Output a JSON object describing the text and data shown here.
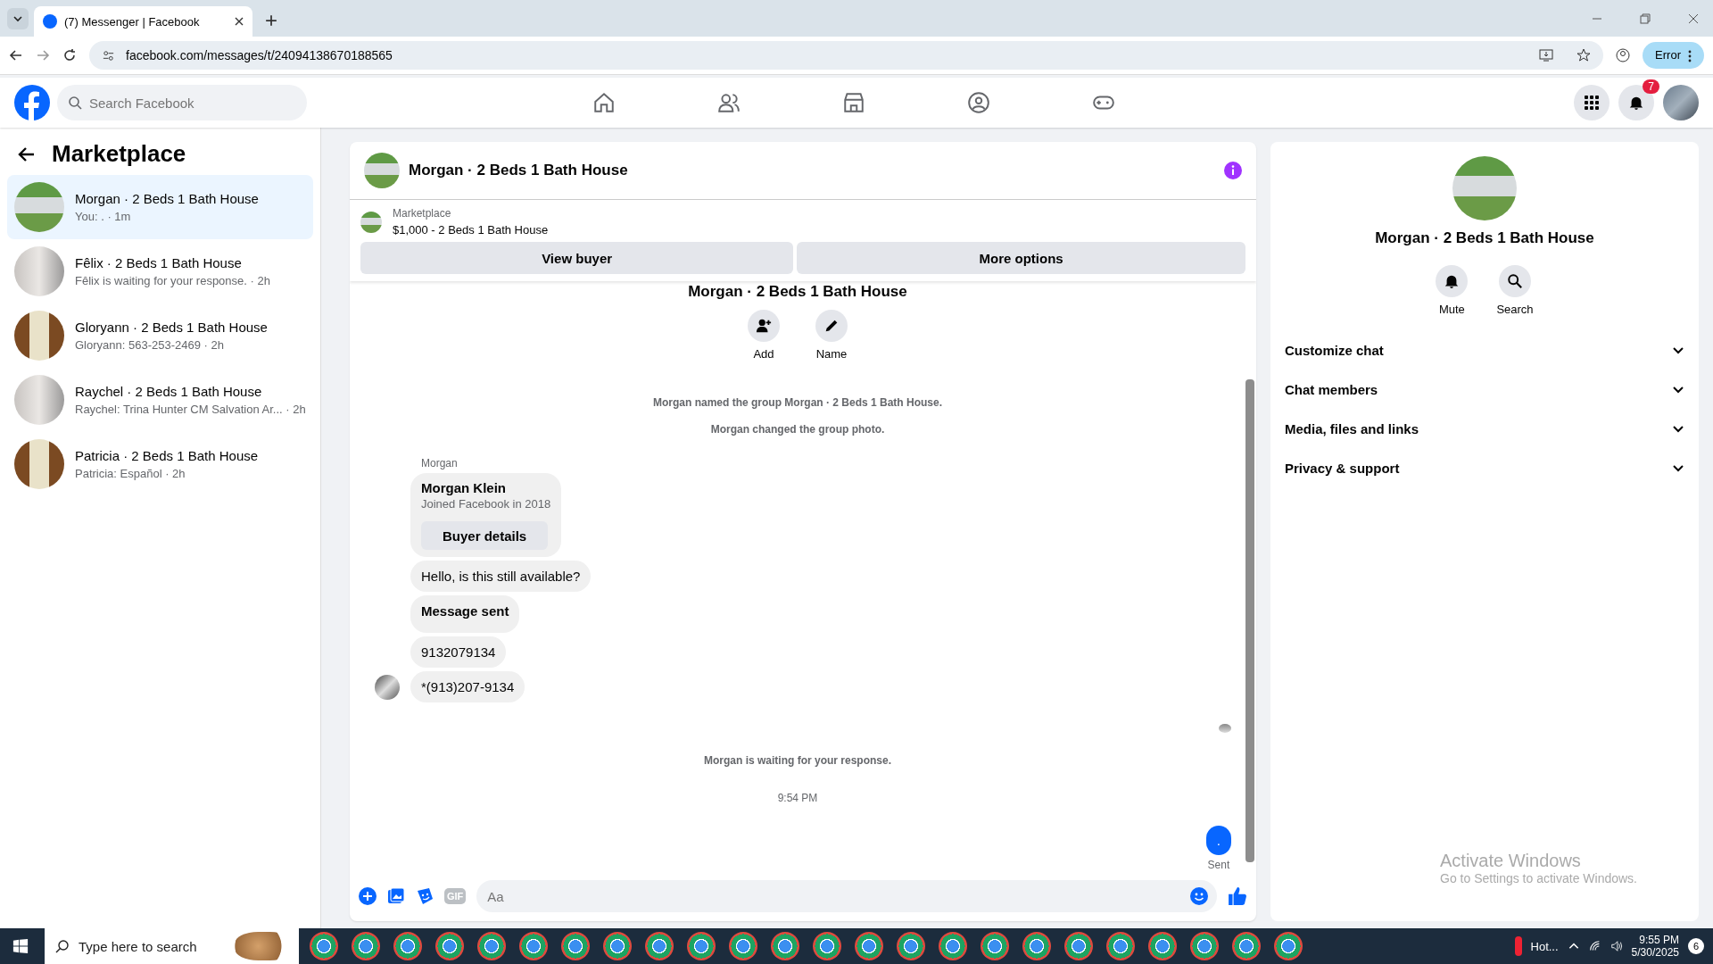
{
  "browser": {
    "tab_title": "(7) Messenger | Facebook",
    "url": "facebook.com/messages/t/24094138670188565",
    "profile_button": "Error"
  },
  "top_nav": {
    "search": {
      "placeholder": "Search Facebook"
    },
    "notification_count": "7"
  },
  "sidebar": {
    "title": "Marketplace",
    "chats": [
      {
        "name": "Morgan · 2 Beds 1 Bath House",
        "preview": "You: . · 1m",
        "selected": true
      },
      {
        "name": "Fêlix · 2 Beds 1 Bath House",
        "preview": "Fêlix is waiting for your response. · 2h",
        "selected": false
      },
      {
        "name": "Gloryann · 2 Beds 1 Bath House",
        "preview": "Gloryann: 563-253-2469 · 2h",
        "selected": false
      },
      {
        "name": "Raychel · 2 Beds 1 Bath House",
        "preview": "Raychel: Trina Hunter CM Salvation Ar... · 2h",
        "selected": false
      },
      {
        "name": "Patricia · 2 Beds 1 Bath House",
        "preview": "Patricia: Español · 2h",
        "selected": false
      }
    ]
  },
  "chat": {
    "title": "Morgan · 2 Beds 1 Bath House",
    "listing": {
      "label": "Marketplace",
      "price_title": "$1,000 - 2 Beds 1 Bath House"
    },
    "buttons": [
      "View buyer",
      "More options"
    ],
    "group_title": "Morgan · 2 Beds 1 Bath House",
    "group_actions": [
      "Add",
      "Name"
    ],
    "events": [
      "Morgan named the group Morgan · 2 Beds 1 Bath House.",
      "Morgan changed the group photo."
    ],
    "sender": "Morgan",
    "buyer_card": {
      "name": "Morgan Klein",
      "joined": "Joined Facebook in 2018",
      "button": "Buyer details"
    },
    "messages": [
      {
        "kind": "plain",
        "text": "Hello, is this still available?"
      },
      {
        "kind": "bold",
        "text": "Message sent"
      },
      {
        "kind": "plain",
        "text": "9132079134"
      },
      {
        "kind": "plain",
        "text": "*(913)207-9134"
      }
    ],
    "status": "Morgan is waiting for your response.",
    "time": "9:54 PM",
    "sent_message": ".",
    "sent_label": "Sent",
    "composer": {
      "gif": "GIF",
      "placeholder": "Aa"
    }
  },
  "details": {
    "title": "Morgan · 2 Beds 1 Bath House",
    "actions": [
      "Mute",
      "Search"
    ],
    "sections": [
      {
        "label": "Customize chat",
        "expanded": false
      },
      {
        "label": "Chat members",
        "expanded": false
      },
      {
        "label": "Media, files and links",
        "expanded": false
      },
      {
        "label": "Privacy & support",
        "expanded": false
      }
    ]
  },
  "activation": {
    "title": "Activate Windows",
    "subtitle": "Go to Settings to activate Windows."
  },
  "taskbar": {
    "search": {
      "placeholder": "Type here to search"
    },
    "weather": "Hot...",
    "time": "9:55 PM",
    "date": "5/30/2025",
    "notification_count": "6"
  }
}
